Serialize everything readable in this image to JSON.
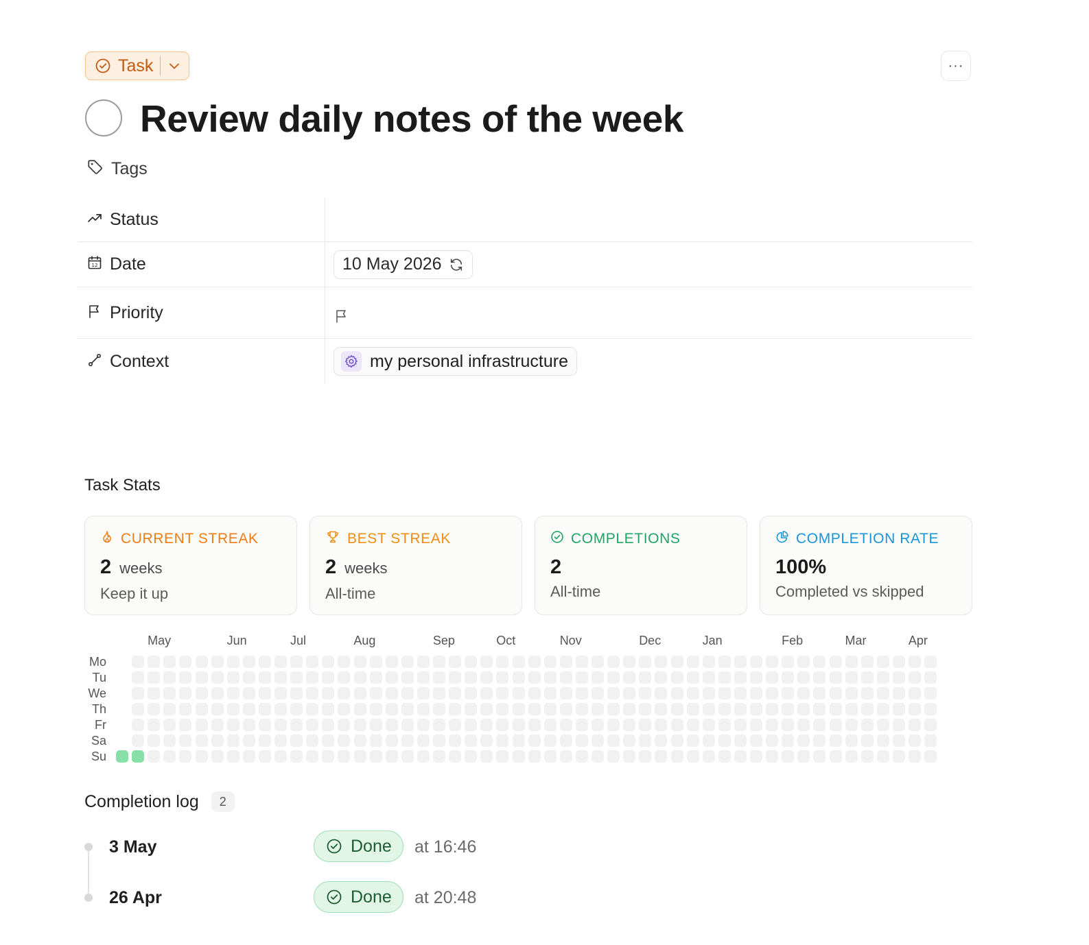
{
  "header": {
    "type_label": "Task",
    "more_label": "···",
    "title": "Review daily notes of the week",
    "tags_label": "Tags"
  },
  "properties": {
    "status_label": "Status",
    "date_label": "Date",
    "date_value": "10 May 2026",
    "priority_label": "Priority",
    "context_label": "Context",
    "context_value": "my personal infrastructure"
  },
  "stats": {
    "section_title": "Task Stats",
    "cards": [
      {
        "label": "CURRENT STREAK",
        "value": "2",
        "unit": "weeks",
        "sub": "Keep it up",
        "color": "#ef7d10",
        "icon": "flame-icon"
      },
      {
        "label": "BEST STREAK",
        "value": "2",
        "unit": "weeks",
        "sub": "All-time",
        "color": "#f08c12",
        "icon": "trophy-icon"
      },
      {
        "label": "COMPLETIONS",
        "value": "2",
        "unit": "",
        "sub": "All-time",
        "color": "#1fa565",
        "icon": "check-circle-icon"
      },
      {
        "label": "COMPLETION RATE",
        "value": "100%",
        "unit": "",
        "sub": "Completed vs skipped",
        "color": "#1796d8",
        "icon": "pie-chart-icon"
      }
    ]
  },
  "heatmap": {
    "months": [
      "May",
      "Jun",
      "Jul",
      "Aug",
      "Sep",
      "Oct",
      "Nov",
      "Dec",
      "Jan",
      "Feb",
      "Mar",
      "Apr"
    ],
    "month_start_weeks": [
      1,
      6,
      10,
      14,
      19,
      23,
      27,
      32,
      36,
      41,
      45,
      49
    ],
    "days": [
      "Mo",
      "Tu",
      "We",
      "Th",
      "Fr",
      "Sa",
      "Su"
    ],
    "week_count": 52,
    "first_week_starts_on": "Su",
    "completed_cells": [
      {
        "week": 0,
        "day": "Su"
      },
      {
        "week": 1,
        "day": "Su"
      }
    ],
    "empty_color": "#f1f1f1",
    "done_color": "#86e0a7"
  },
  "completion_log": {
    "title": "Completion log",
    "count": "2",
    "entries": [
      {
        "date": "3 May",
        "status": "Done",
        "time": "at 16:46"
      },
      {
        "date": "26 Apr",
        "status": "Done",
        "time": "at 20:48"
      }
    ]
  }
}
